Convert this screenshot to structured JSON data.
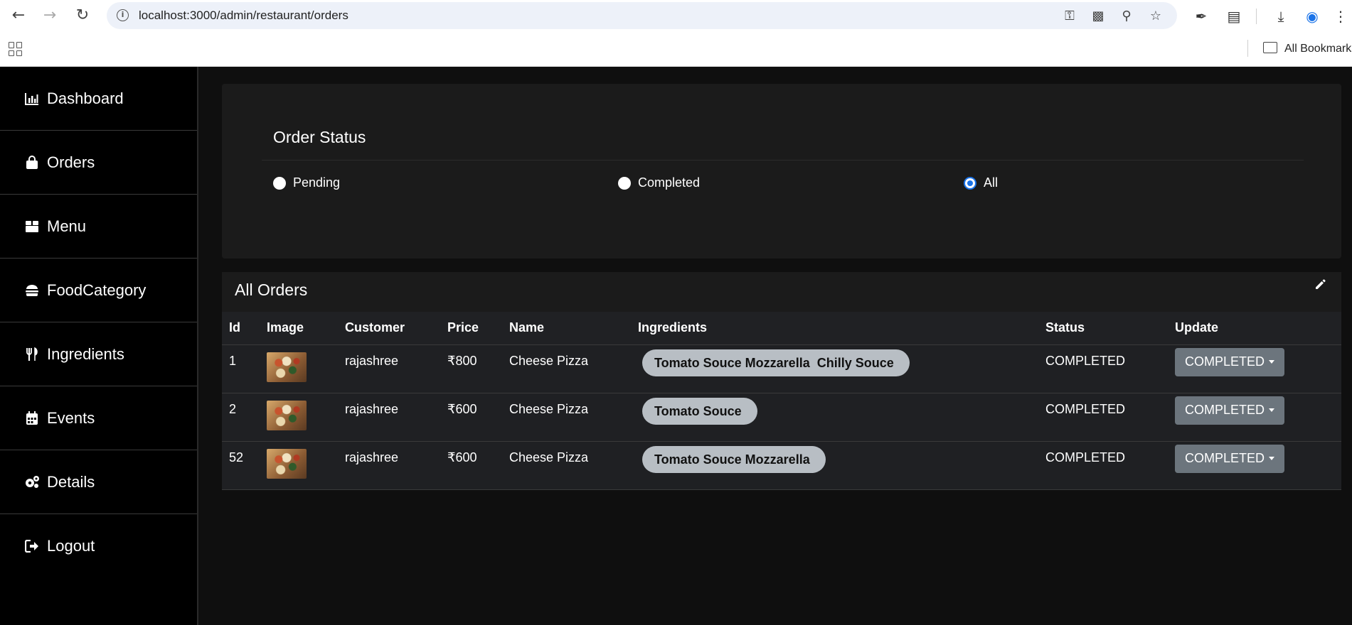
{
  "browser": {
    "url": "localhost:3000/admin/restaurant/orders",
    "bookmarks_label": "All Bookmarks"
  },
  "sidebar": {
    "items": [
      {
        "label": "Dashboard",
        "icon": "chart-icon"
      },
      {
        "label": "Orders",
        "icon": "shopping-bag-icon"
      },
      {
        "label": "Menu",
        "icon": "box-icon"
      },
      {
        "label": "FoodCategory",
        "icon": "burger-icon"
      },
      {
        "label": "Ingredients",
        "icon": "utensils-icon"
      },
      {
        "label": "Events",
        "icon": "calendar-icon"
      },
      {
        "label": "Details",
        "icon": "gears-icon"
      },
      {
        "label": "Logout",
        "icon": "logout-icon"
      }
    ]
  },
  "status_filter": {
    "title": "Order Status",
    "options": [
      "Pending",
      "Completed",
      "All"
    ],
    "selected": "All"
  },
  "orders": {
    "title": "All Orders",
    "columns": [
      "Id",
      "Image",
      "Customer",
      "Price",
      "Name",
      "Ingredients",
      "Status",
      "Update"
    ],
    "rows": [
      {
        "id": "1",
        "customer": "rajashree",
        "price": "₹800",
        "name": "Cheese Pizza",
        "ingredients": "Tomato Souce Mozzarella  Chilly Souce",
        "status": "COMPLETED",
        "update": "COMPLETED"
      },
      {
        "id": "2",
        "customer": "rajashree",
        "price": "₹600",
        "name": "Cheese Pizza",
        "ingredients": "Tomato Souce",
        "status": "COMPLETED",
        "update": "COMPLETED"
      },
      {
        "id": "52",
        "customer": "rajashree",
        "price": "₹600",
        "name": "Cheese Pizza",
        "ingredients": "Tomato Souce Mozzarella",
        "status": "COMPLETED",
        "update": "COMPLETED"
      }
    ]
  },
  "colors": {
    "sidebar_bg": "#000000",
    "page_bg": "#0f0f0f",
    "card_bg": "#1b1b1b",
    "pill_bg": "#b8bec4",
    "button_bg": "#6c757d",
    "radio_accent": "#1a73e8"
  }
}
